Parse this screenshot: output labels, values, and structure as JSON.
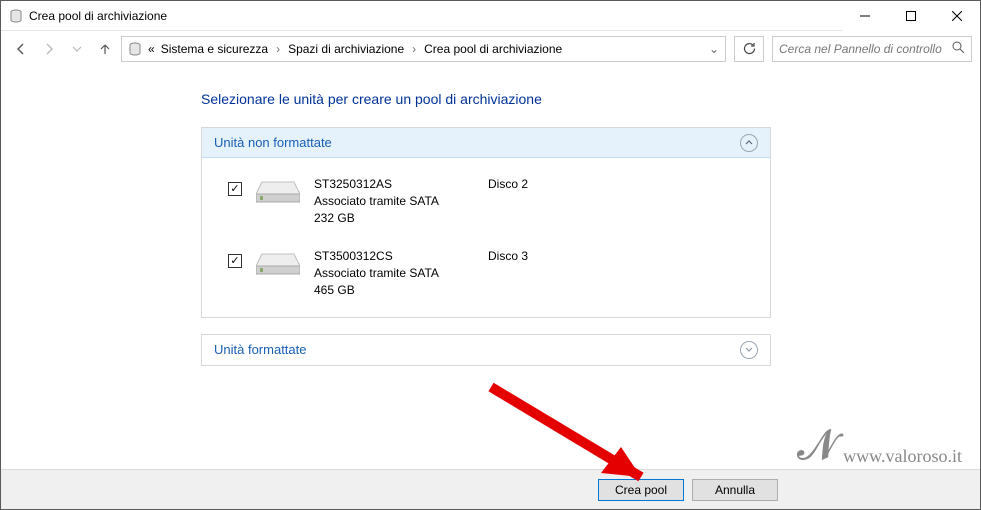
{
  "window": {
    "title": "Crea pool di archiviazione"
  },
  "breadcrumbs": {
    "prefix": "«",
    "item1": "Sistema e sicurezza",
    "item2": "Spazi di archiviazione",
    "item3": "Crea pool di archiviazione"
  },
  "search": {
    "placeholder": "Cerca nel Pannello di controllo"
  },
  "page": {
    "title": "Selezionare le unità per creare un pool di archiviazione"
  },
  "sections": {
    "unformatted": {
      "title": "Unità non formattate"
    },
    "formatted": {
      "title": "Unità formattate"
    }
  },
  "drives": [
    {
      "model": "ST3250312AS",
      "connection": "Associato tramite SATA",
      "size": "232 GB",
      "disk": "Disco 2",
      "checked": true
    },
    {
      "model": "ST3500312CS",
      "connection": "Associato tramite SATA",
      "size": "465 GB",
      "disk": "Disco 3",
      "checked": true
    }
  ],
  "buttons": {
    "create": "Crea pool",
    "cancel": "Annulla"
  },
  "watermark": {
    "text": "www.valoroso.it"
  }
}
